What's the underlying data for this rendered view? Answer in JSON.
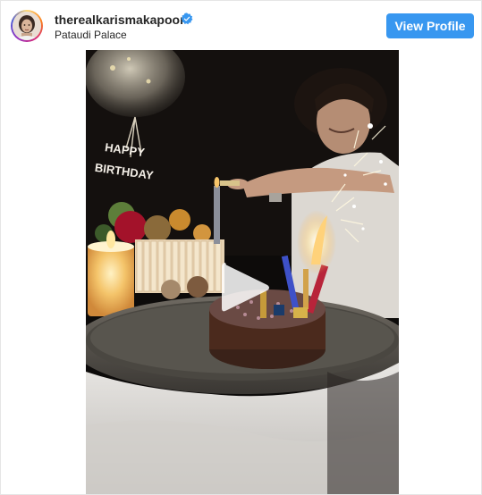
{
  "post": {
    "username": "therealkarismakapoor",
    "verified": true,
    "location": "Pataudi Palace",
    "view_profile_label": "View Profile"
  },
  "media": {
    "type": "video",
    "cake_topper_text": "HAPPY BIRTHDAY"
  },
  "icons": {
    "verified": "verified-badge-icon",
    "play": "play-icon"
  },
  "colors": {
    "button": "#3897f0",
    "verified": "#3897f0",
    "text": "#262626"
  }
}
